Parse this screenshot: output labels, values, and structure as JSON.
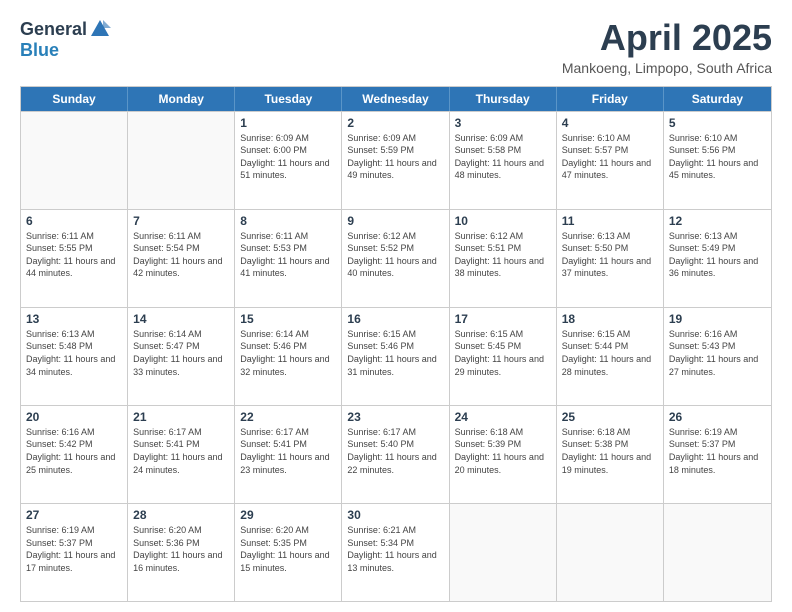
{
  "logo": {
    "general": "General",
    "blue": "Blue"
  },
  "title": "April 2025",
  "location": "Mankoeng, Limpopo, South Africa",
  "weekdays": [
    "Sunday",
    "Monday",
    "Tuesday",
    "Wednesday",
    "Thursday",
    "Friday",
    "Saturday"
  ],
  "weeks": [
    [
      {
        "day": "",
        "empty": true
      },
      {
        "day": "",
        "empty": true
      },
      {
        "day": "1",
        "sunrise": "6:09 AM",
        "sunset": "6:00 PM",
        "daylight": "11 hours and 51 minutes."
      },
      {
        "day": "2",
        "sunrise": "6:09 AM",
        "sunset": "5:59 PM",
        "daylight": "11 hours and 49 minutes."
      },
      {
        "day": "3",
        "sunrise": "6:09 AM",
        "sunset": "5:58 PM",
        "daylight": "11 hours and 48 minutes."
      },
      {
        "day": "4",
        "sunrise": "6:10 AM",
        "sunset": "5:57 PM",
        "daylight": "11 hours and 47 minutes."
      },
      {
        "day": "5",
        "sunrise": "6:10 AM",
        "sunset": "5:56 PM",
        "daylight": "11 hours and 45 minutes."
      }
    ],
    [
      {
        "day": "6",
        "sunrise": "6:11 AM",
        "sunset": "5:55 PM",
        "daylight": "11 hours and 44 minutes."
      },
      {
        "day": "7",
        "sunrise": "6:11 AM",
        "sunset": "5:54 PM",
        "daylight": "11 hours and 42 minutes."
      },
      {
        "day": "8",
        "sunrise": "6:11 AM",
        "sunset": "5:53 PM",
        "daylight": "11 hours and 41 minutes."
      },
      {
        "day": "9",
        "sunrise": "6:12 AM",
        "sunset": "5:52 PM",
        "daylight": "11 hours and 40 minutes."
      },
      {
        "day": "10",
        "sunrise": "6:12 AM",
        "sunset": "5:51 PM",
        "daylight": "11 hours and 38 minutes."
      },
      {
        "day": "11",
        "sunrise": "6:13 AM",
        "sunset": "5:50 PM",
        "daylight": "11 hours and 37 minutes."
      },
      {
        "day": "12",
        "sunrise": "6:13 AM",
        "sunset": "5:49 PM",
        "daylight": "11 hours and 36 minutes."
      }
    ],
    [
      {
        "day": "13",
        "sunrise": "6:13 AM",
        "sunset": "5:48 PM",
        "daylight": "11 hours and 34 minutes."
      },
      {
        "day": "14",
        "sunrise": "6:14 AM",
        "sunset": "5:47 PM",
        "daylight": "11 hours and 33 minutes."
      },
      {
        "day": "15",
        "sunrise": "6:14 AM",
        "sunset": "5:46 PM",
        "daylight": "11 hours and 32 minutes."
      },
      {
        "day": "16",
        "sunrise": "6:15 AM",
        "sunset": "5:46 PM",
        "daylight": "11 hours and 31 minutes."
      },
      {
        "day": "17",
        "sunrise": "6:15 AM",
        "sunset": "5:45 PM",
        "daylight": "11 hours and 29 minutes."
      },
      {
        "day": "18",
        "sunrise": "6:15 AM",
        "sunset": "5:44 PM",
        "daylight": "11 hours and 28 minutes."
      },
      {
        "day": "19",
        "sunrise": "6:16 AM",
        "sunset": "5:43 PM",
        "daylight": "11 hours and 27 minutes."
      }
    ],
    [
      {
        "day": "20",
        "sunrise": "6:16 AM",
        "sunset": "5:42 PM",
        "daylight": "11 hours and 25 minutes."
      },
      {
        "day": "21",
        "sunrise": "6:17 AM",
        "sunset": "5:41 PM",
        "daylight": "11 hours and 24 minutes."
      },
      {
        "day": "22",
        "sunrise": "6:17 AM",
        "sunset": "5:41 PM",
        "daylight": "11 hours and 23 minutes."
      },
      {
        "day": "23",
        "sunrise": "6:17 AM",
        "sunset": "5:40 PM",
        "daylight": "11 hours and 22 minutes."
      },
      {
        "day": "24",
        "sunrise": "6:18 AM",
        "sunset": "5:39 PM",
        "daylight": "11 hours and 20 minutes."
      },
      {
        "day": "25",
        "sunrise": "6:18 AM",
        "sunset": "5:38 PM",
        "daylight": "11 hours and 19 minutes."
      },
      {
        "day": "26",
        "sunrise": "6:19 AM",
        "sunset": "5:37 PM",
        "daylight": "11 hours and 18 minutes."
      }
    ],
    [
      {
        "day": "27",
        "sunrise": "6:19 AM",
        "sunset": "5:37 PM",
        "daylight": "11 hours and 17 minutes."
      },
      {
        "day": "28",
        "sunrise": "6:20 AM",
        "sunset": "5:36 PM",
        "daylight": "11 hours and 16 minutes."
      },
      {
        "day": "29",
        "sunrise": "6:20 AM",
        "sunset": "5:35 PM",
        "daylight": "11 hours and 15 minutes."
      },
      {
        "day": "30",
        "sunrise": "6:21 AM",
        "sunset": "5:34 PM",
        "daylight": "11 hours and 13 minutes."
      },
      {
        "day": "",
        "empty": true
      },
      {
        "day": "",
        "empty": true
      },
      {
        "day": "",
        "empty": true
      }
    ]
  ]
}
